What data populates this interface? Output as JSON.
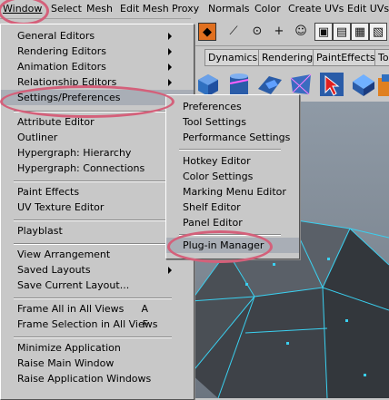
{
  "menubar": {
    "items": [
      "Window",
      "Select",
      "Mesh",
      "Edit Mesh",
      "Proxy",
      "Normals",
      "Color",
      "Create UVs",
      "Edit UVs"
    ]
  },
  "shelf_tabs": [
    "Dynamics",
    "Rendering",
    "PaintEffects",
    "To"
  ],
  "window_menu": {
    "items": [
      {
        "label": "General Editors",
        "submenu": true
      },
      {
        "label": "Rendering Editors",
        "submenu": true
      },
      {
        "label": "Animation Editors",
        "submenu": true
      },
      {
        "label": "Relationship Editors",
        "submenu": true
      },
      {
        "label": "Settings/Preferences",
        "submenu": true,
        "highlighted": true
      },
      {
        "label": "Attribute Editor"
      },
      {
        "label": "Outliner"
      },
      {
        "label": "Hypergraph: Hierarchy"
      },
      {
        "label": "Hypergraph: Connections"
      },
      {
        "label": "Paint Effects"
      },
      {
        "label": "UV Texture Editor"
      },
      {
        "label": "Playblast"
      },
      {
        "label": "View Arrangement",
        "submenu": true
      },
      {
        "label": "Saved Layouts",
        "submenu": true
      },
      {
        "label": "Save Current Layout..."
      },
      {
        "label": "Frame All in All Views",
        "accel": "A"
      },
      {
        "label": "Frame Selection in All Views",
        "accel": "F"
      },
      {
        "label": "Minimize Application"
      },
      {
        "label": "Raise Main Window"
      },
      {
        "label": "Raise Application Windows"
      }
    ]
  },
  "settings_submenu": {
    "items": [
      {
        "label": "Preferences"
      },
      {
        "label": "Tool Settings"
      },
      {
        "label": "Performance Settings"
      },
      {
        "label": "Hotkey Editor"
      },
      {
        "label": "Color Settings"
      },
      {
        "label": "Marking Menu Editor"
      },
      {
        "label": "Shelf Editor"
      },
      {
        "label": "Panel Editor"
      },
      {
        "label": "Plug-in Manager",
        "highlighted": true
      }
    ]
  },
  "colors": {
    "highlight": "#a9aeb6",
    "annotation": "#d4607a",
    "mesh_edge": "#3ad0f0",
    "mesh_face": "#4a4f55"
  }
}
